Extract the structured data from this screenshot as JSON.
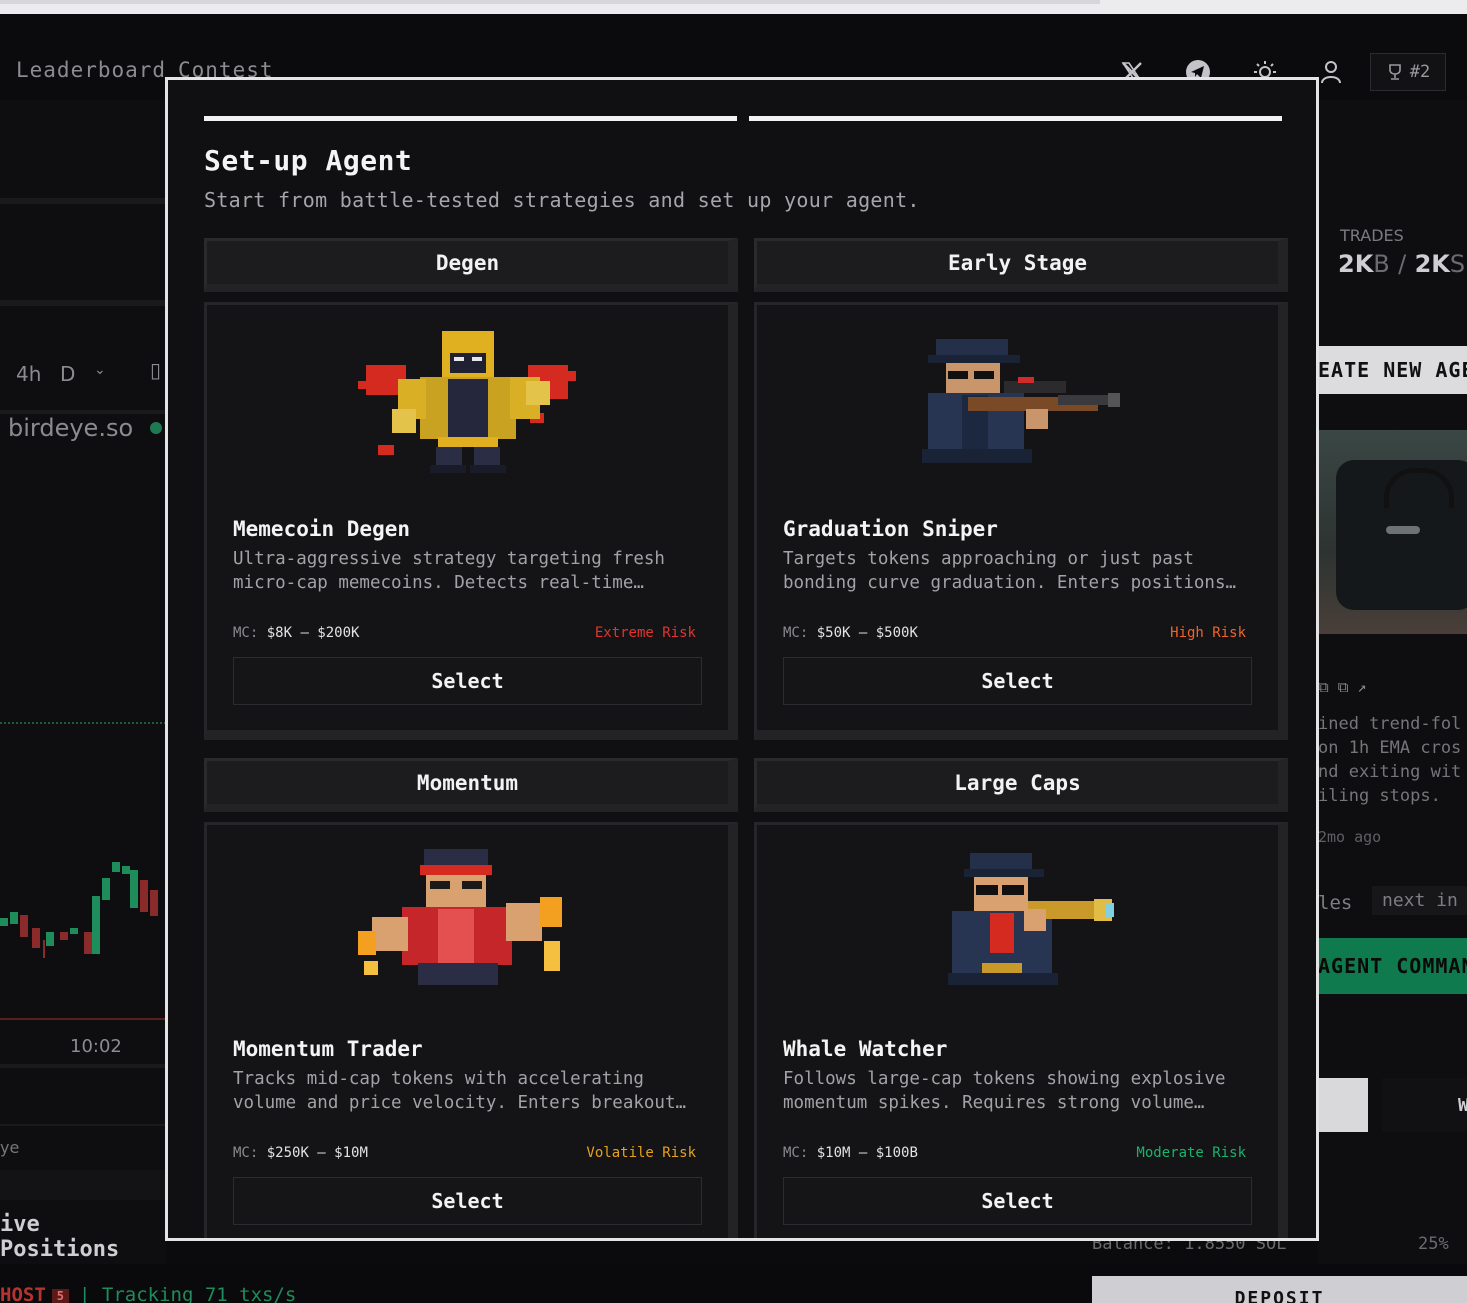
{
  "nav": {
    "links": [
      "Leaderboard",
      "Contest"
    ],
    "rank": "#2"
  },
  "background": {
    "timeframes": [
      "4h",
      "D"
    ],
    "source": "birdeye.so",
    "time_label": "10:02",
    "ye_label": "ye",
    "positions_title": "ive Positions",
    "trades_label": "TRADES",
    "trades_buy": "2K",
    "trades_buy_unit": "B",
    "trades_sep": "/",
    "trades_sell": "2K",
    "trades_sell_unit": "S",
    "create_button": "EATE NEW AGE",
    "desc_snippet": "ined trend-fol\non 1h EMA cros\nnd exiting wit\niling stops.",
    "ago": "2mo ago",
    "rules_text": "les",
    "next_text": "next in",
    "agent_command": "AGENT COMMAN",
    "w_label": "W",
    "ghost": "HOST",
    "ghost_badge": "5",
    "tracking": "| Tracking 71 txs/s",
    "balance": "Balance: 1.8550 SOL",
    "pct": "25%",
    "deposit": "DEPOSIT"
  },
  "modal": {
    "title": "Set-up Agent",
    "subtitle": "Start from battle-tested strategies and set up your agent.",
    "strategies": [
      {
        "category": "Degen",
        "name": "Memecoin Degen",
        "description": "Ultra-aggressive strategy targeting fresh\nmicro-cap memecoins. Detects real-time…",
        "mc_label": "MC:",
        "mc_range": "$8K – $200K",
        "risk": "Extreme Risk",
        "risk_color": "#e0352f",
        "select": "Select"
      },
      {
        "category": "Early Stage",
        "name": "Graduation Sniper",
        "description": "Targets tokens approaching or just past\nbonding curve graduation. Enters positions…",
        "mc_label": "MC:",
        "mc_range": "$50K – $500K",
        "risk": "High Risk",
        "risk_color": "#f0632a",
        "select": "Select"
      },
      {
        "category": "Momentum",
        "name": "Momentum Trader",
        "description": "Tracks mid-cap tokens with accelerating\nvolume and price velocity. Enters breakout…",
        "mc_label": "MC:",
        "mc_range": "$250K – $10M",
        "risk": "Volatile Risk",
        "risk_color": "#e6a11c",
        "select": "Select"
      },
      {
        "category": "Large Caps",
        "name": "Whale Watcher",
        "description": "Follows large-cap tokens showing explosive\nmomentum spikes. Requires strong volume…",
        "mc_label": "MC:",
        "mc_range": "$10M – $100B",
        "risk": "Moderate Risk",
        "risk_color": "#19b36b",
        "select": "Select"
      }
    ]
  }
}
